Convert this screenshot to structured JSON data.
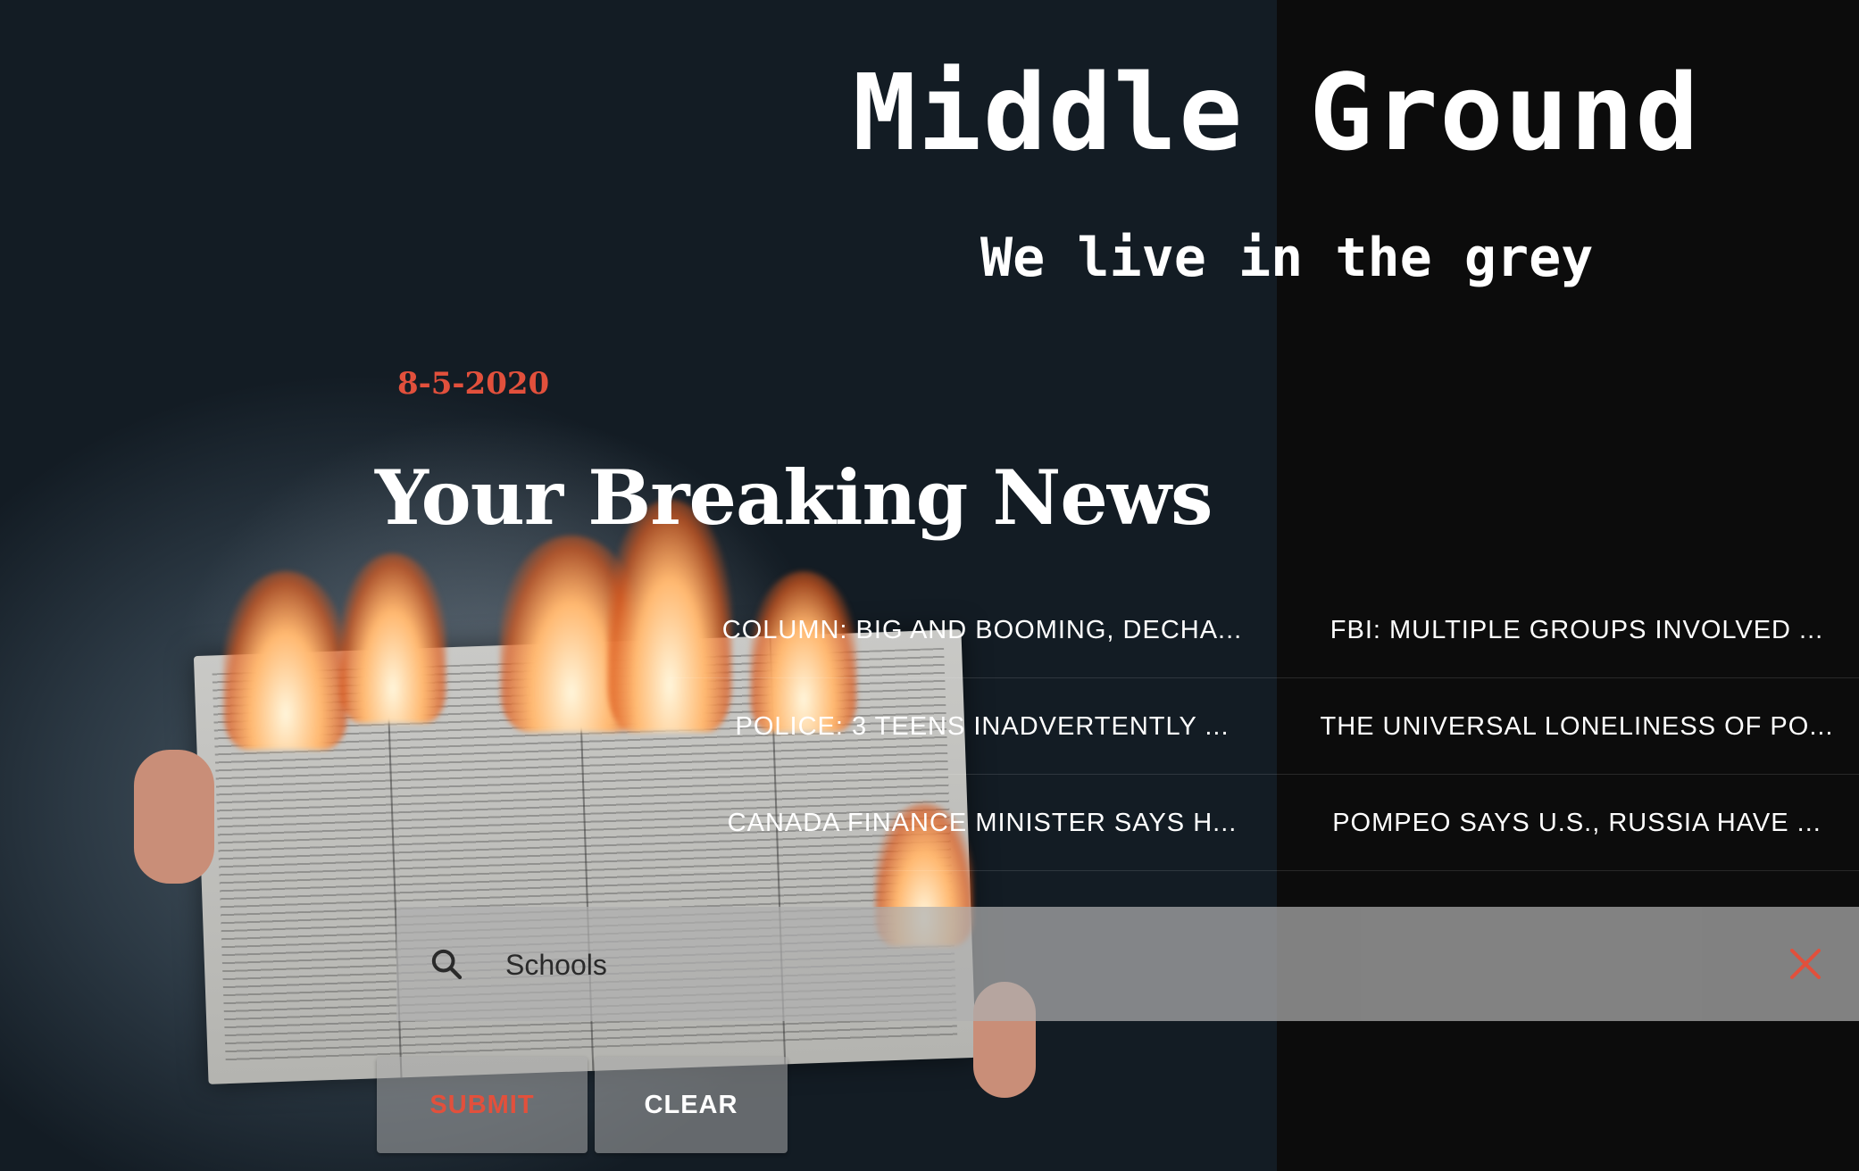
{
  "site": {
    "title": "Middle Ground",
    "tagline": "We live in the grey"
  },
  "date": "8-5-2020",
  "headline": "Your Breaking News",
  "news": {
    "rows": [
      [
        "COLUMN: BIG AND BOOMING, DECHA...",
        "FBI: MULTIPLE GROUPS INVOLVED ..."
      ],
      [
        "POLICE: 3 TEENS INADVERTENTLY ...",
        "THE UNIVERSAL LONELINESS OF PO..."
      ],
      [
        "CANADA FINANCE MINISTER SAYS H...",
        "POMPEO SAYS U.S., RUSSIA HAVE ..."
      ]
    ]
  },
  "search": {
    "value": "Schools"
  },
  "buttons": {
    "submit": "SUBMIT",
    "clear": "CLEAR"
  },
  "colors": {
    "accent": "#e2503c",
    "panel": "#0c0c0c",
    "text": "#ffffff"
  },
  "icons": {
    "search": "search-icon",
    "clear": "close-icon"
  }
}
